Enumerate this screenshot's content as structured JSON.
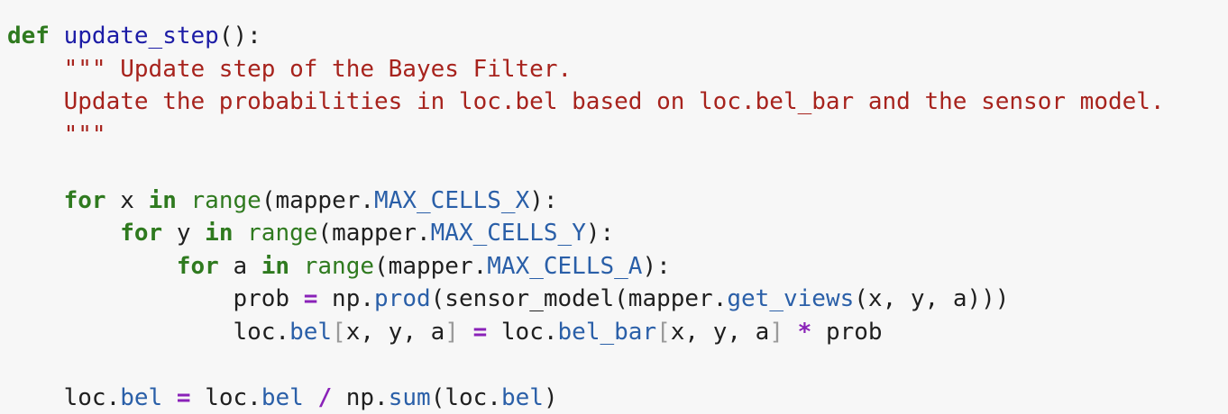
{
  "code": {
    "def_kw": "def",
    "func_name": "update_step",
    "func_sig": "():",
    "doc_line1": "\"\"\" Update step of the Bayes Filter.",
    "doc_line2": "Update the probabilities in loc.bel based on loc.bel_bar and the sensor model.",
    "doc_line3": "\"\"\"",
    "kw_for": "for",
    "kw_in": "in",
    "builtin_range": "range",
    "var_x": "x",
    "var_y": "y",
    "var_a": "a",
    "mapper_prefix": "(mapper.",
    "const_x": "MAX_CELLS_X",
    "const_y": "MAX_CELLS_Y",
    "const_a": "MAX_CELLS_A",
    "close_colon": "):",
    "prob_assign": "prob",
    "eq": "=",
    "np_prefix": "np.",
    "func_prod": "prod",
    "sensor_call": "(sensor_model(mapper.",
    "func_get_views": "get_views",
    "get_views_args": "(x, y, a)))",
    "loc_prefix": "loc.",
    "attr_bel": "bel",
    "attr_bel_bar": "bel_bar",
    "bracket_open": "[",
    "bracket_close": "]",
    "index_args": "x, y, a",
    "mult": "*",
    "var_prob": "prob",
    "div": "/",
    "func_sum": "sum",
    "sum_args": "(loc.",
    "close_paren": ")"
  }
}
